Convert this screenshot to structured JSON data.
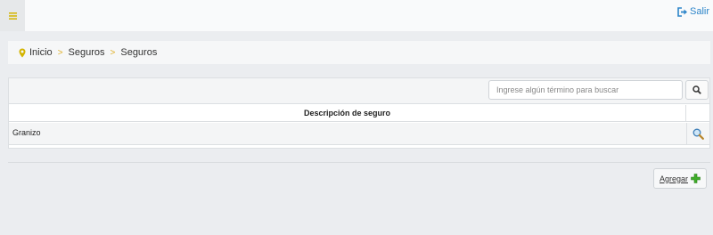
{
  "topbar": {
    "menu_icon": "hamburger-icon",
    "logout_label": "Salir",
    "logout_icon": "sign-out-icon",
    "accent": "#2c84c9"
  },
  "breadcrumb": {
    "icon": "map-marker-icon",
    "items": [
      "Inicio",
      "Seguros",
      "Seguros"
    ],
    "separator": ">"
  },
  "search": {
    "placeholder": "Ingrese algún término para buscar",
    "button_icon": "search-icon"
  },
  "table": {
    "columns": [
      "Descripción de seguro"
    ],
    "rows": [
      {
        "descripcion": "Granizo",
        "action_icon": "magnifier-icon"
      }
    ]
  },
  "actions": {
    "add_label": "Agregar",
    "add_icon": "plus-icon"
  }
}
